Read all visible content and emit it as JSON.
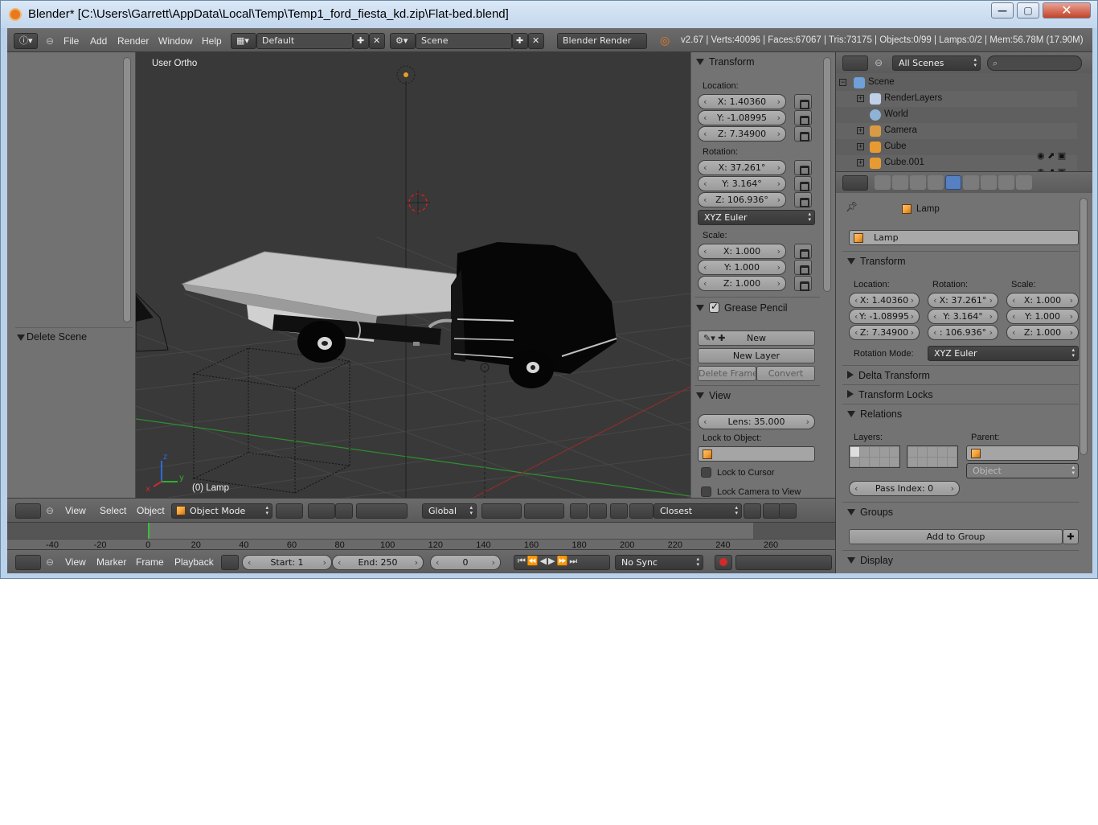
{
  "window": {
    "title": "Blender* [C:\\Users\\Garrett\\AppData\\Local\\Temp\\Temp1_ford_fiesta_kd.zip\\Flat-bed.blend]",
    "minimize": "—",
    "maximize": "▢",
    "close": "✕"
  },
  "info_header": {
    "menus": [
      "File",
      "Add",
      "Render",
      "Window",
      "Help"
    ],
    "screen_layout": "Default",
    "scene": "Scene",
    "engine": "Blender Render",
    "stats": "v2.67 | Verts:40096 | Faces:67067 | Tris:73175 | Objects:0/99 | Lamps:0/2 | Mem:56.78M (17.90M)"
  },
  "toolshelf": {
    "operator_panel": "Delete Scene"
  },
  "viewport": {
    "view_name": "User Ortho",
    "active_object_label": "(0) Lamp",
    "axis_x": "x",
    "axis_y": "y",
    "axis_z": "z",
    "colors": {
      "background": "#393939",
      "grid": "#474747",
      "x_axis": "#8f2d2d",
      "y_axis": "#2f8f2f"
    }
  },
  "npanel": {
    "transform": {
      "title": "Transform",
      "location_label": "Location:",
      "location": [
        "X: 1.40360",
        "Y: -1.08995",
        "Z: 7.34900"
      ],
      "rotation_label": "Rotation:",
      "rotation": [
        "X: 37.261°",
        "Y: 3.164°",
        "Z: 106.936°"
      ],
      "rotation_mode": "XYZ Euler",
      "scale_label": "Scale:",
      "scale": [
        "X: 1.000",
        "Y: 1.000",
        "Z: 1.000"
      ]
    },
    "grease_pencil": {
      "title": "Grease Pencil",
      "new": "New",
      "new_layer": "New Layer",
      "delete_frame": "Delete Frame",
      "convert": "Convert"
    },
    "view": {
      "title": "View",
      "lens": "Lens: 35.000",
      "lock_to_object": "Lock to Object:",
      "lock_to_cursor": "Lock to Cursor",
      "lock_camera_to_view": "Lock Camera to View"
    }
  },
  "view3d_header": {
    "menus": [
      "View",
      "Select",
      "Object"
    ],
    "mode": "Object Mode",
    "orientation": "Global",
    "snap_target": "Closest"
  },
  "timeline": {
    "ticks": [
      "-40",
      "-20",
      "0",
      "20",
      "40",
      "60",
      "80",
      "100",
      "120",
      "140",
      "160",
      "180",
      "200",
      "220",
      "240",
      "260"
    ],
    "menus": [
      "View",
      "Marker",
      "Frame",
      "Playback"
    ],
    "start": "Start: 1",
    "end": "End: 250",
    "current_frame": "0",
    "sync": "No Sync",
    "playhead_frame": 0
  },
  "outliner": {
    "display_filter": "All Scenes",
    "rows": [
      "Scene",
      "RenderLayers",
      "World",
      "Camera",
      "Cube",
      "Cube.001"
    ]
  },
  "properties": {
    "breadcrumb": "Lamp",
    "object_name": "Lamp",
    "transform_title": "Transform",
    "location_label": "Location:",
    "rotation_label": "Rotation:",
    "scale_label": "Scale:",
    "location": [
      "X: 1.40360",
      "Y: -1.08995",
      "Z: 7.34900"
    ],
    "rotation": [
      "X: 37.261°",
      "Y: 3.164°",
      ": 106.936°"
    ],
    "scale": [
      "X: 1.000",
      "Y: 1.000",
      "Z: 1.000"
    ],
    "rotation_mode_label": "Rotation Mode:",
    "rotation_mode": "XYZ Euler",
    "delta_transform": "Delta Transform",
    "transform_locks": "Transform Locks",
    "relations": "Relations",
    "layers_label": "Layers:",
    "parent_label": "Parent:",
    "parent_type": "Object",
    "pass_index": "Pass Index: 0",
    "groups": "Groups",
    "add_to_group": "Add to Group",
    "display": "Display"
  }
}
